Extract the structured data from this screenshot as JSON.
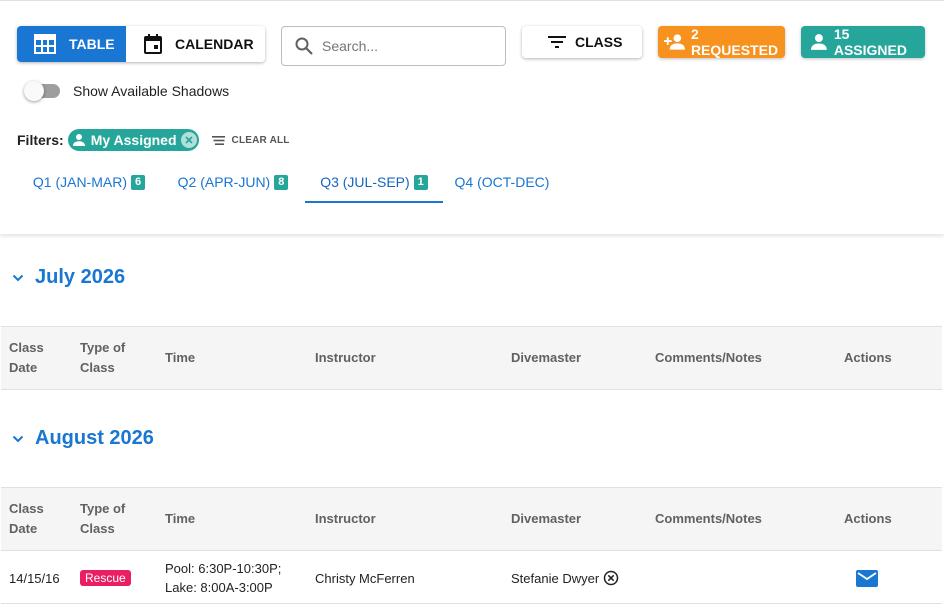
{
  "toolbar": {
    "table_label": "TABLE",
    "calendar_label": "CALENDAR",
    "search_placeholder": "Search...",
    "class_label": "CLASS",
    "requested_label": "2 REQUESTED",
    "assigned_label": "15 ASSIGNED"
  },
  "shadow_toggle": {
    "label": "Show Available Shadows",
    "checked": false
  },
  "filters": {
    "label": "Filters:",
    "chip_label": "My Assigned",
    "clear_label": "CLEAR ALL"
  },
  "tabs": [
    {
      "label": "Q1 (JAN-MAR)",
      "badge": "6"
    },
    {
      "label": "Q2 (APR-JUN)",
      "badge": "8"
    },
    {
      "label": "Q3 (JUL-SEP)",
      "badge": "1"
    },
    {
      "label": "Q4 (OCT-DEC)",
      "badge": ""
    }
  ],
  "selected_tab": "Q3 (JUL-SEP)",
  "columns": {
    "class_date": [
      "Class",
      "Date"
    ],
    "type_of_class": [
      "Type of",
      "Class"
    ],
    "time": "Time",
    "instructor": "Instructor",
    "divemaster": "Divemaster",
    "comments": "Comments/Notes",
    "actions": "Actions"
  },
  "months": [
    {
      "title": "July 2026",
      "rows": []
    },
    {
      "title": "August 2026",
      "rows": [
        {
          "date": "14/15/16",
          "type": "Rescue",
          "time_lines": [
            "Pool: 6:30P-10:30P;",
            "Lake: 8:00A-3:00P"
          ],
          "instructor": "Christy McFerren",
          "divemaster": "Stefanie Dwyer",
          "comments": ""
        }
      ]
    }
  ],
  "colors": {
    "primary": "#1976d2",
    "requested": "#f7921e",
    "assigned": "#26a69a",
    "rescue_badge": "#e91e63"
  },
  "icons": {
    "table": "table-icon",
    "calendar": "calendar-icon",
    "search": "search-icon",
    "filter": "filter-icon",
    "requested": "person-add-icon",
    "assigned": "person-icon",
    "chip_remove": "close-circle-icon",
    "clear_all": "clear-all-icon",
    "month_toggle": "chevron-down-icon",
    "email": "email-icon"
  }
}
